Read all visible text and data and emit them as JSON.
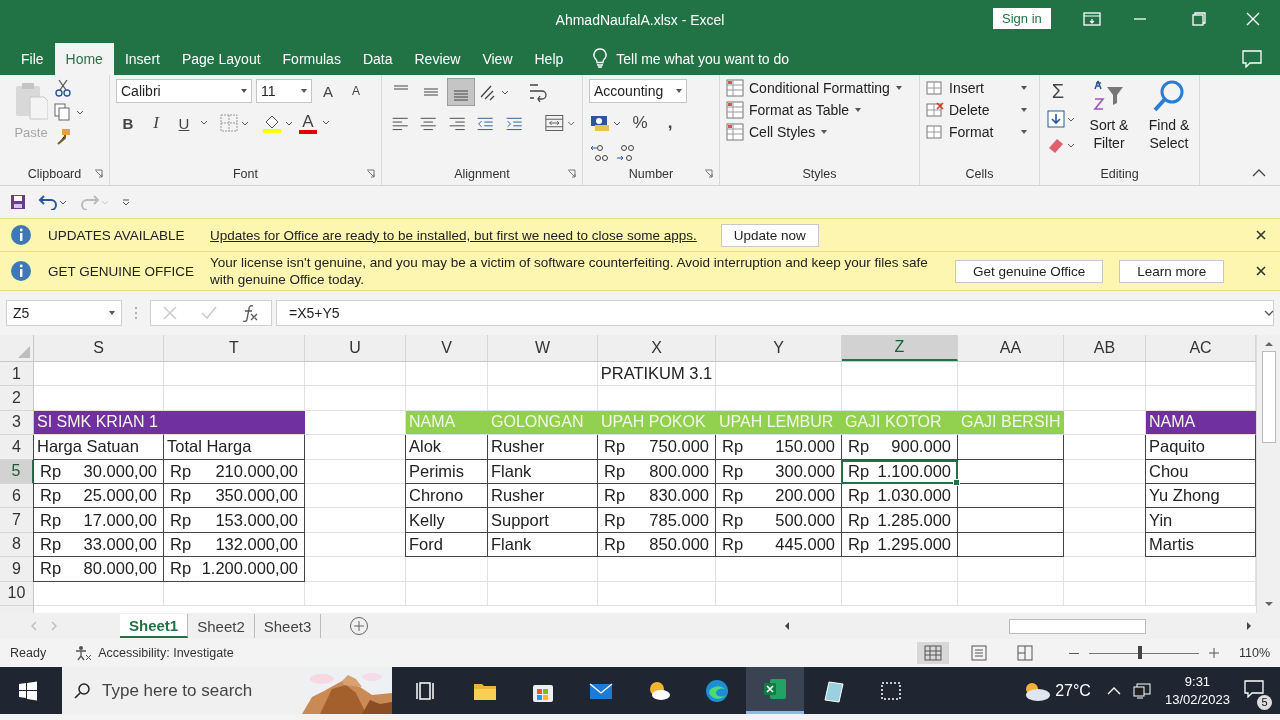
{
  "window": {
    "title": "AhmadNaufalA.xlsx  -  Excel",
    "sign_in": "Sign in"
  },
  "tabs": [
    {
      "label": "File",
      "selected": false
    },
    {
      "label": "Home",
      "selected": true
    },
    {
      "label": "Insert",
      "selected": false
    },
    {
      "label": "Page Layout",
      "selected": false
    },
    {
      "label": "Formulas",
      "selected": false
    },
    {
      "label": "Data",
      "selected": false
    },
    {
      "label": "Review",
      "selected": false
    },
    {
      "label": "View",
      "selected": false
    },
    {
      "label": "Help",
      "selected": false
    }
  ],
  "tell_me": {
    "placeholder": "Tell me what you want to do"
  },
  "ribbon": {
    "clipboard": {
      "label": "Clipboard",
      "paste": "Paste"
    },
    "font": {
      "label": "Font",
      "font_name": "Calibri",
      "font_size": "11",
      "size_buttons": [
        "A",
        "A"
      ],
      "format_buttons": [
        {
          "kind": "bold",
          "label": "B"
        },
        {
          "kind": "italic",
          "label": "I"
        },
        {
          "kind": "underline",
          "label": "U"
        }
      ],
      "font_color_label": "A"
    },
    "alignment": {
      "label": "Alignment",
      "vertical": [
        {
          "kind": "top",
          "selected": false
        },
        {
          "kind": "middle",
          "selected": false
        },
        {
          "kind": "bottom",
          "selected": true
        }
      ]
    },
    "number": {
      "label": "Number",
      "format": "Accounting",
      "percent": "%",
      "comma": ","
    },
    "styles": {
      "label": "Styles",
      "items": [
        "Conditional Formatting",
        "Format as Table",
        "Cell Styles"
      ]
    },
    "cells": {
      "label": "Cells",
      "items": [
        "Insert",
        "Delete",
        "Format"
      ]
    },
    "editing": {
      "label": "Editing",
      "sum": "Σ",
      "sort": "Sort & Filter",
      "find": "Find & Select"
    }
  },
  "notifications": [
    {
      "kind": "update",
      "title": "UPDATES AVAILABLE",
      "message": "Updates for Office are ready to be installed, but first we need to close some apps.",
      "buttons": [
        "Update now"
      ]
    },
    {
      "kind": "genuine",
      "title": "GET GENUINE OFFICE",
      "message": "Your license isn't genuine, and you may be a victim of software counterfeiting. Avoid interruption and keep your files safe with genuine Office today.",
      "buttons": [
        "Get genuine Office",
        "Learn more"
      ]
    }
  ],
  "formula_bar": {
    "name_box": "Z5",
    "formula": "=X5+Y5"
  },
  "columns": [
    {
      "label": "S",
      "selected": false
    },
    {
      "label": "T",
      "selected": false
    },
    {
      "label": "U",
      "selected": false
    },
    {
      "label": "V",
      "selected": false
    },
    {
      "label": "W",
      "selected": false
    },
    {
      "label": "X",
      "selected": false
    },
    {
      "label": "Y",
      "selected": false
    },
    {
      "label": "Z",
      "selected": true
    },
    {
      "label": "AA",
      "selected": false
    },
    {
      "label": "AB",
      "selected": false
    },
    {
      "label": "AC",
      "selected": false
    }
  ],
  "rows": [
    {
      "number": "1",
      "selected": false,
      "cells": [
        null,
        null,
        null,
        null,
        null,
        {
          "kind": "text",
          "text": "PRATIKUM 3.1",
          "boxed": false,
          "selected": false
        },
        null,
        null,
        null,
        null,
        null
      ]
    },
    {
      "number": "2",
      "selected": false,
      "cells": [
        null,
        null,
        null,
        null,
        null,
        null,
        null,
        null,
        null,
        null,
        null
      ]
    },
    {
      "number": "3",
      "selected": false,
      "cells": [
        {
          "kind": "header",
          "text": "SI SMK KRIAN 1",
          "color": "#7030a0",
          "boxed": false,
          "selected": false
        },
        {
          "kind": "header",
          "color": "#7030a0",
          "boxed": false,
          "selected": false
        },
        null,
        {
          "kind": "header",
          "text": "NAMA",
          "color": "#92d050",
          "boxed": false,
          "selected": false
        },
        {
          "kind": "header",
          "text": "GOLONGAN",
          "color": "#92d050",
          "boxed": false,
          "selected": false
        },
        {
          "kind": "header",
          "text": "UPAH POKOK",
          "color": "#92d050",
          "boxed": false,
          "selected": false
        },
        {
          "kind": "header",
          "text": "UPAH LEMBUR",
          "color": "#92d050",
          "boxed": false,
          "selected": false
        },
        {
          "kind": "header",
          "text": "GAJI KOTOR",
          "color": "#92d050",
          "boxed": false,
          "selected": false
        },
        {
          "kind": "header",
          "text": "GAJI BERSIH",
          "color": "#92d050",
          "boxed": false,
          "selected": false
        },
        null,
        {
          "kind": "header",
          "text": "NAMA",
          "color": "#7030a0",
          "boxed": false,
          "selected": false
        }
      ]
    },
    {
      "number": "4",
      "selected": false,
      "cells": [
        {
          "kind": "text",
          "text": "Harga Satuan",
          "boxed": true,
          "selected": false
        },
        {
          "kind": "text",
          "text": "Total Harga",
          "boxed": true,
          "selected": false
        },
        null,
        {
          "kind": "text",
          "text": "Alok",
          "boxed": true,
          "selected": false
        },
        {
          "kind": "text",
          "text": "Rusher",
          "boxed": true,
          "selected": false
        },
        {
          "kind": "money",
          "symbol": "Rp",
          "amount": "750.000",
          "boxed": true,
          "selected": false
        },
        {
          "kind": "money",
          "symbol": "Rp",
          "amount": "150.000",
          "boxed": true,
          "selected": false
        },
        {
          "kind": "money",
          "symbol": "Rp",
          "amount": "900.000",
          "boxed": true,
          "selected": false
        },
        {
          "kind": "empty",
          "boxed": true,
          "selected": false
        },
        null,
        {
          "kind": "text",
          "text": "Paquito",
          "boxed": true,
          "selected": false
        }
      ]
    },
    {
      "number": "5",
      "selected": true,
      "cells": [
        {
          "kind": "money",
          "symbol": "Rp",
          "amount": "30.000,00",
          "boxed": true,
          "selected": false
        },
        {
          "kind": "money",
          "symbol": "Rp",
          "amount": "210.000,00",
          "boxed": true,
          "selected": false
        },
        null,
        {
          "kind": "text",
          "text": "Perimis",
          "boxed": true,
          "selected": false
        },
        {
          "kind": "text",
          "text": "Flank",
          "boxed": true,
          "selected": false
        },
        {
          "kind": "money",
          "symbol": "Rp",
          "amount": "800.000",
          "boxed": true,
          "selected": false
        },
        {
          "kind": "money",
          "symbol": "Rp",
          "amount": "300.000",
          "boxed": true,
          "selected": false
        },
        {
          "kind": "money",
          "symbol": "Rp",
          "amount": "1.100.000",
          "boxed": true,
          "selected": true
        },
        {
          "kind": "empty",
          "boxed": true,
          "selected": false
        },
        null,
        {
          "kind": "text",
          "text": "Chou",
          "boxed": true,
          "selected": false
        }
      ]
    },
    {
      "number": "6",
      "selected": false,
      "cells": [
        {
          "kind": "money",
          "symbol": "Rp",
          "amount": "25.000,00",
          "boxed": true,
          "selected": false
        },
        {
          "kind": "money",
          "symbol": "Rp",
          "amount": "350.000,00",
          "boxed": true,
          "selected": false
        },
        null,
        {
          "kind": "text",
          "text": "Chrono",
          "boxed": true,
          "selected": false
        },
        {
          "kind": "text",
          "text": "Rusher",
          "boxed": true,
          "selected": false
        },
        {
          "kind": "money",
          "symbol": "Rp",
          "amount": "830.000",
          "boxed": true,
          "selected": false
        },
        {
          "kind": "money",
          "symbol": "Rp",
          "amount": "200.000",
          "boxed": true,
          "selected": false
        },
        {
          "kind": "money",
          "symbol": "Rp",
          "amount": "1.030.000",
          "boxed": true,
          "selected": false
        },
        {
          "kind": "empty",
          "boxed": true,
          "selected": false
        },
        null,
        {
          "kind": "text",
          "text": "Yu Zhong",
          "boxed": true,
          "selected": false
        }
      ]
    },
    {
      "number": "7",
      "selected": false,
      "cells": [
        {
          "kind": "money",
          "symbol": "Rp",
          "amount": "17.000,00",
          "boxed": true,
          "selected": false
        },
        {
          "kind": "money",
          "symbol": "Rp",
          "amount": "153.000,00",
          "boxed": true,
          "selected": false
        },
        null,
        {
          "kind": "text",
          "text": "Kelly",
          "boxed": true,
          "selected": false
        },
        {
          "kind": "text",
          "text": "Support",
          "boxed": true,
          "selected": false
        },
        {
          "kind": "money",
          "symbol": "Rp",
          "amount": "785.000",
          "boxed": true,
          "selected": false
        },
        {
          "kind": "money",
          "symbol": "Rp",
          "amount": "500.000",
          "boxed": true,
          "selected": false
        },
        {
          "kind": "money",
          "symbol": "Rp",
          "amount": "1.285.000",
          "boxed": true,
          "selected": false
        },
        {
          "kind": "empty",
          "boxed": true,
          "selected": false
        },
        null,
        {
          "kind": "text",
          "text": "Yin",
          "boxed": true,
          "selected": false
        }
      ]
    },
    {
      "number": "8",
      "selected": false,
      "cells": [
        {
          "kind": "money",
          "symbol": "Rp",
          "amount": "33.000,00",
          "boxed": true,
          "selected": false
        },
        {
          "kind": "money",
          "symbol": "Rp",
          "amount": "132.000,00",
          "boxed": true,
          "selected": false
        },
        null,
        {
          "kind": "text",
          "text": "Ford",
          "boxed": true,
          "selected": false
        },
        {
          "kind": "text",
          "text": "Flank",
          "boxed": true,
          "selected": false
        },
        {
          "kind": "money",
          "symbol": "Rp",
          "amount": "850.000",
          "boxed": true,
          "selected": false
        },
        {
          "kind": "money",
          "symbol": "Rp",
          "amount": "445.000",
          "boxed": true,
          "selected": false
        },
        {
          "kind": "money",
          "symbol": "Rp",
          "amount": "1.295.000",
          "boxed": true,
          "selected": false
        },
        {
          "kind": "empty",
          "boxed": true,
          "selected": false
        },
        null,
        {
          "kind": "text",
          "text": "Martis",
          "boxed": true,
          "selected": false
        }
      ]
    },
    {
      "number": "9",
      "selected": false,
      "cells": [
        {
          "kind": "money",
          "symbol": "Rp",
          "amount": "80.000,00",
          "boxed": true,
          "selected": false
        },
        {
          "kind": "money",
          "symbol": "Rp",
          "amount": "1.200.000,00",
          "boxed": true,
          "selected": false
        },
        null,
        null,
        null,
        null,
        null,
        null,
        null,
        null,
        null
      ]
    },
    {
      "number": "10",
      "selected": false,
      "cells": [
        null,
        null,
        null,
        null,
        null,
        null,
        null,
        null,
        null,
        null,
        null
      ]
    }
  ],
  "sheets": [
    {
      "label": "Sheet1",
      "selected": true
    },
    {
      "label": "Sheet2",
      "selected": false
    },
    {
      "label": "Sheet3",
      "selected": false
    }
  ],
  "status_bar": {
    "status": "Ready",
    "accessibility": "Accessibility: Investigate",
    "zoom": "110%",
    "level": 0.46
  },
  "taskbar": {
    "search": {
      "placeholder": "Type here to search"
    },
    "apps": [
      {
        "kind": "task-view",
        "selected": false
      },
      {
        "kind": "folder",
        "selected": false
      },
      {
        "kind": "store",
        "selected": false
      },
      {
        "kind": "mail",
        "selected": false
      },
      {
        "kind": "weather-app",
        "selected": false
      },
      {
        "kind": "browser",
        "selected": false
      },
      {
        "kind": "excel",
        "selected": true
      },
      {
        "kind": "notepad",
        "selected": false
      },
      {
        "kind": "snip",
        "selected": false
      }
    ],
    "temperature": "27°C",
    "time": "9:31",
    "date": "13/02/2023",
    "notifications": "5"
  }
}
